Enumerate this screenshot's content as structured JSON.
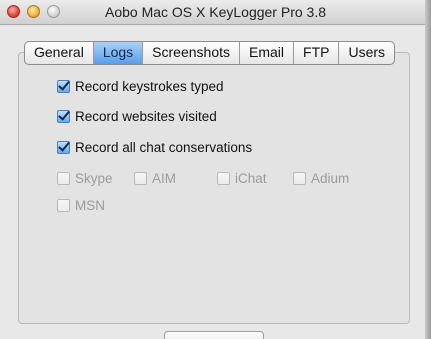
{
  "window": {
    "title": "Aobo Mac OS X KeyLogger Pro 3.8"
  },
  "tabs": [
    {
      "label": "General",
      "active": false
    },
    {
      "label": "Logs",
      "active": true
    },
    {
      "label": "Screenshots",
      "active": false
    },
    {
      "label": "Email",
      "active": false
    },
    {
      "label": "FTP",
      "active": false
    },
    {
      "label": "Users",
      "active": false
    }
  ],
  "options": {
    "record_keystrokes": {
      "label": "Record keystrokes typed",
      "checked": true
    },
    "record_websites": {
      "label": "Record websites visited",
      "checked": true
    },
    "record_chat": {
      "label": "Record all chat conservations",
      "checked": true
    }
  },
  "chat_clients": {
    "skype": {
      "label": "Skype",
      "checked": false,
      "enabled": false
    },
    "aim": {
      "label": "AIM",
      "checked": false,
      "enabled": false
    },
    "ichat": {
      "label": "iChat",
      "checked": false,
      "enabled": false
    },
    "adium": {
      "label": "Adium",
      "checked": false,
      "enabled": false
    },
    "msn": {
      "label": "MSN",
      "checked": false,
      "enabled": false
    }
  },
  "colors": {
    "accent": "#5a9ee8",
    "window_bg": "#e8e8e8",
    "disabled_text": "#9b9b9b"
  }
}
